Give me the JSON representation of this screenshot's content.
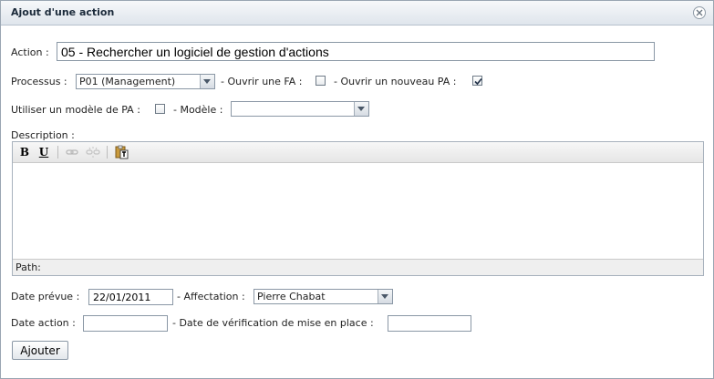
{
  "dialog": {
    "title": "Ajout d'une action"
  },
  "form": {
    "action_label": "Action :",
    "action_value": "05 - Rechercher un logiciel de gestion d'actions",
    "processus_label": "Processus :",
    "processus_value": "P01 (Management)",
    "ouvrir_fa_label": "- Ouvrir une FA :",
    "ouvrir_fa_checked": false,
    "ouvrir_pa_label": "- Ouvrir un nouveau PA :",
    "ouvrir_pa_checked": true,
    "modele_pa_label": "Utiliser un modèle de PA :",
    "modele_pa_checked": false,
    "modele_label": "- Modèle :",
    "modele_value": "",
    "description_label": "Description :",
    "editor_path_label": "Path:",
    "date_prevue_label": "Date prévue :",
    "date_prevue_value": "22/01/2011",
    "affectation_label": "- Affectation :",
    "affectation_value": "Pierre Chabat",
    "date_action_label": "Date action :",
    "date_action_value": "",
    "date_verif_label": "- Date de vérification de mise en place :",
    "date_verif_value": "",
    "submit_label": "Ajouter"
  },
  "toolbar": {
    "bold_label": "B",
    "underline_label": "U"
  },
  "icons": {
    "close": "close-icon",
    "link": "link-icon",
    "unlink": "unlink-icon",
    "paste_text": "paste-text-icon",
    "dropdown": "chevron-down-icon",
    "check": "check-icon"
  }
}
